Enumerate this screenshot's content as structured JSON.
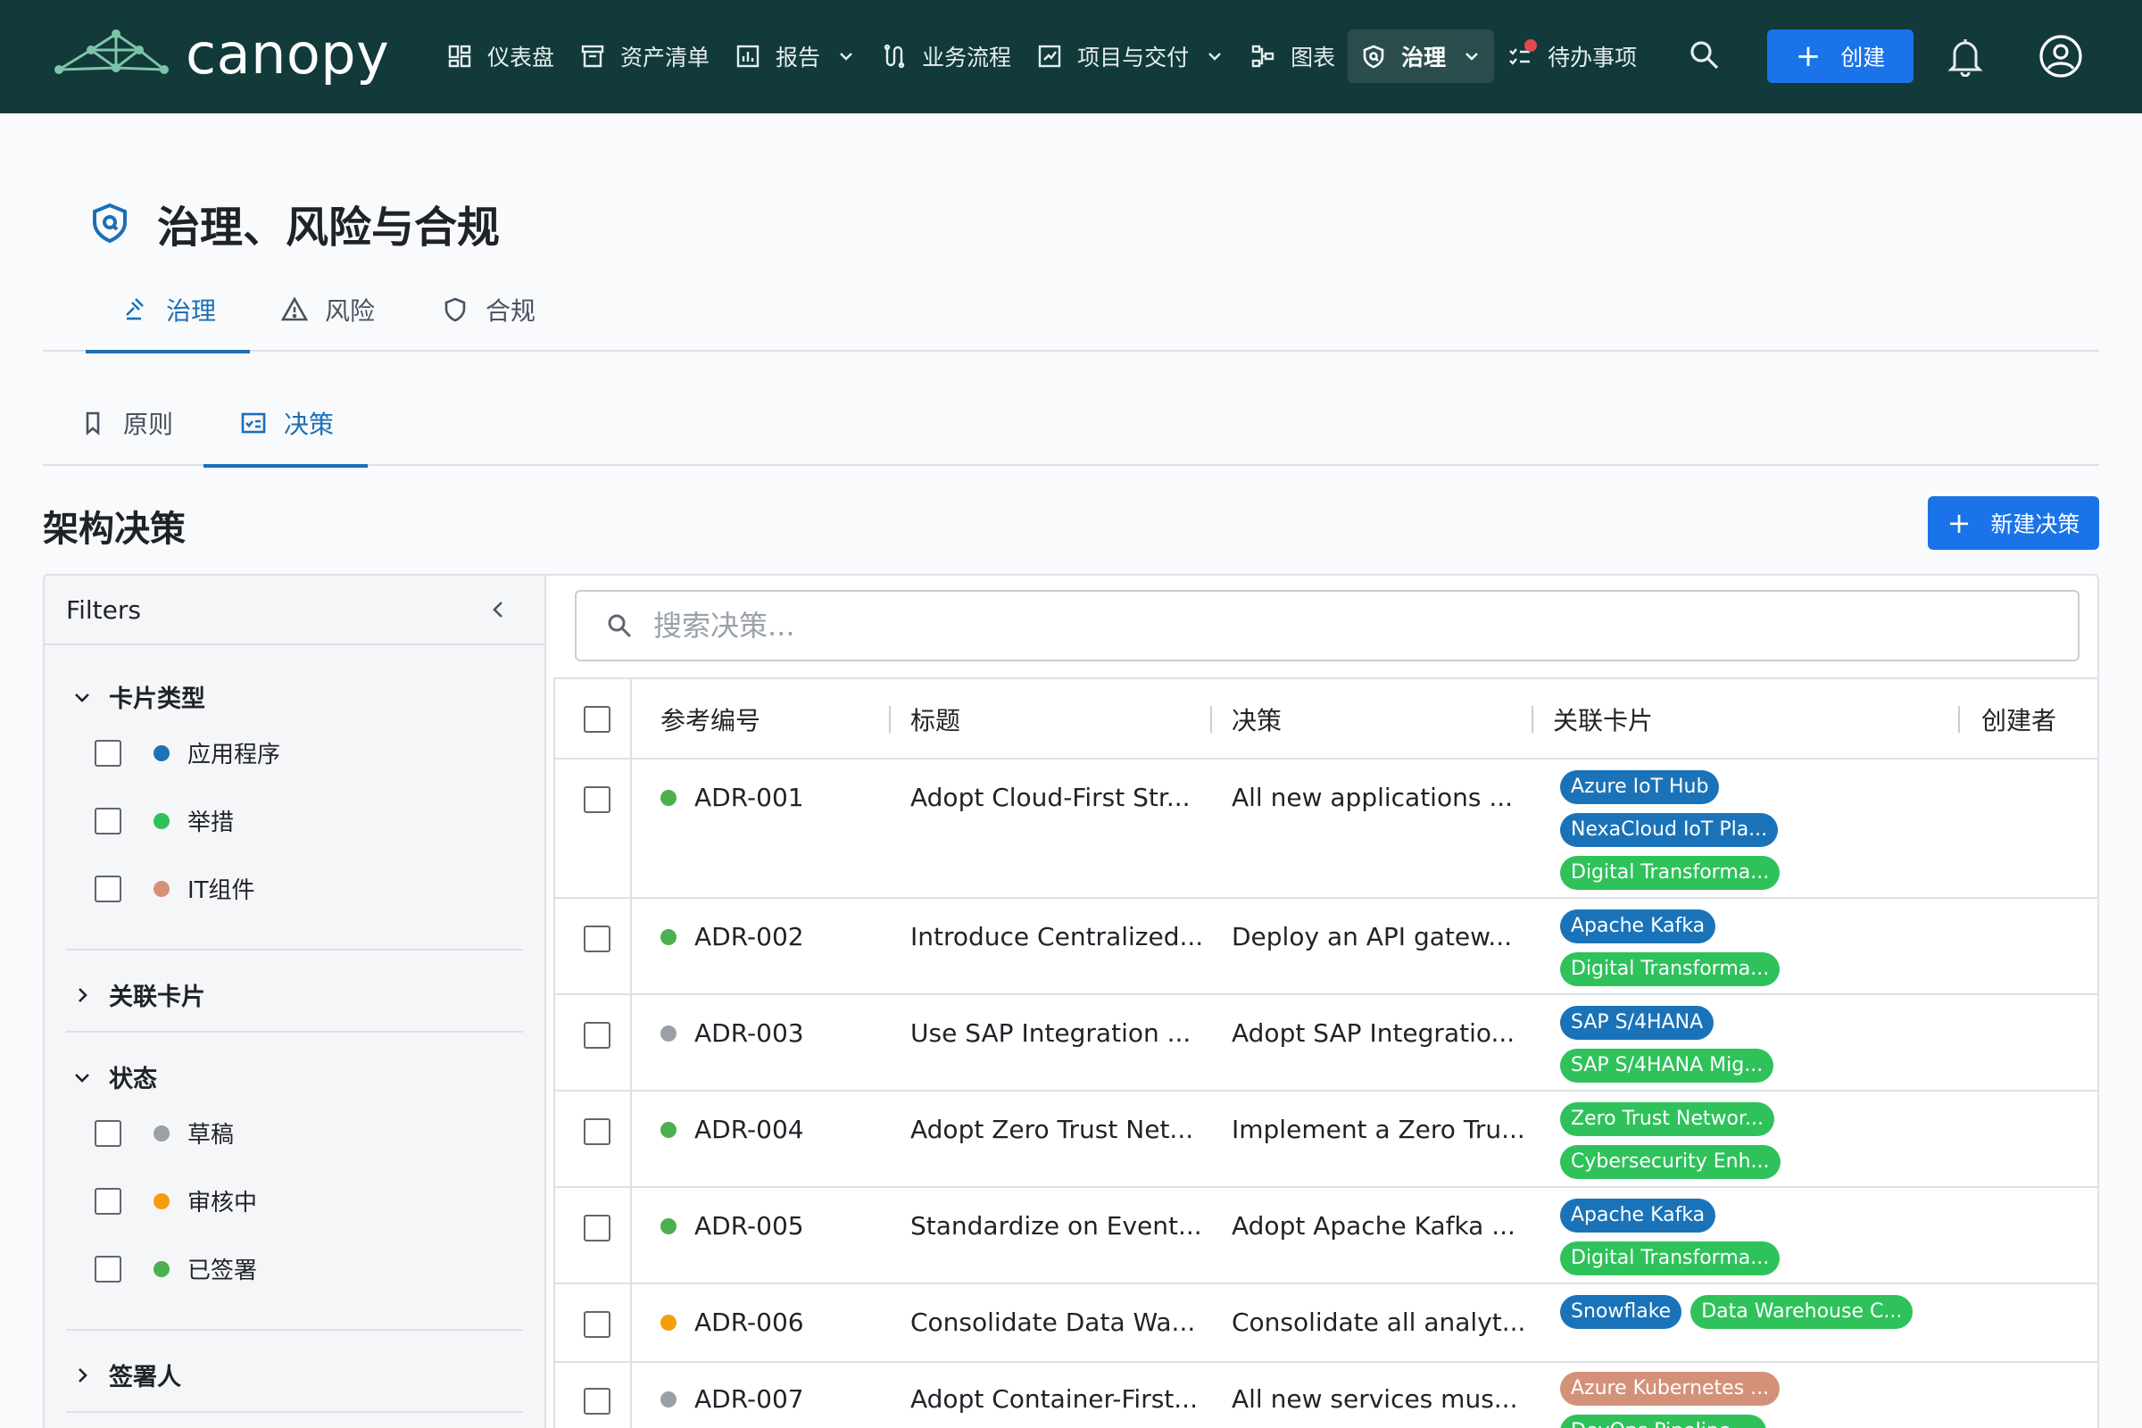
{
  "app": {
    "name": "canopy"
  },
  "nav": {
    "items": [
      {
        "label": "仪表盘",
        "icon": "dashboard-icon"
      },
      {
        "label": "资产清单",
        "icon": "inventory-icon"
      },
      {
        "label": "报告",
        "icon": "reports-icon",
        "dropdown": true
      },
      {
        "label": "业务流程",
        "icon": "workflow-icon"
      },
      {
        "label": "项目与交付",
        "icon": "delivery-icon",
        "dropdown": true
      },
      {
        "label": "图表",
        "icon": "diagram-icon"
      },
      {
        "label": "治理",
        "icon": "governance-shield-icon",
        "dropdown": true,
        "active": true
      },
      {
        "label": "待办事项",
        "icon": "todo-icon",
        "badge": true
      }
    ],
    "create_label": "创建"
  },
  "page": {
    "title": "治理、风险与合规",
    "tabs": [
      {
        "label": "治理",
        "active": true
      },
      {
        "label": "风险"
      },
      {
        "label": "合规"
      }
    ],
    "subtabs": [
      {
        "label": "原则"
      },
      {
        "label": "决策",
        "active": true
      }
    ],
    "section_title": "架构决策",
    "new_button": "新建决策"
  },
  "filters": {
    "title": "Filters",
    "groups": [
      {
        "label": "卡片类型",
        "expanded": true,
        "options": [
          {
            "label": "应用程序",
            "color": "#1a73e8"
          },
          {
            "label": "举措",
            "color": "#22c55e"
          },
          {
            "label": "IT组件",
            "color": "#d4917a"
          }
        ]
      },
      {
        "label": "关联卡片",
        "expanded": false
      },
      {
        "label": "状态",
        "expanded": true,
        "options": [
          {
            "label": "草稿",
            "color": "#9aa0a6"
          },
          {
            "label": "审核中",
            "color": "#f59e0b"
          },
          {
            "label": "已签署",
            "color": "#4caf50"
          }
        ]
      },
      {
        "label": "签署人",
        "expanded": false
      }
    ]
  },
  "search": {
    "placeholder": "搜索决策..."
  },
  "table": {
    "columns": [
      "参考编号",
      "标题",
      "决策",
      "关联卡片",
      "创建者"
    ],
    "rows": [
      {
        "ref": "ADR-001",
        "status_color": "#4caf50",
        "title": "Adopt Cloud-First Str...",
        "decision": "All new applications ...",
        "tags": [
          {
            "label": "Azure IoT Hub",
            "color": "#1a73b8"
          },
          {
            "label": "NexaCloud IoT Pla...",
            "color": "#1a73b8"
          },
          {
            "label": "Digital Transforma...",
            "color": "#2fc25b"
          }
        ]
      },
      {
        "ref": "ADR-002",
        "status_color": "#4caf50",
        "title": "Introduce Centralized...",
        "decision": "Deploy an API gatew...",
        "tags": [
          {
            "label": "Apache Kafka",
            "color": "#1a73b8"
          },
          {
            "label": "Digital Transforma...",
            "color": "#2fc25b"
          }
        ]
      },
      {
        "ref": "ADR-003",
        "status_color": "#9aa0a6",
        "title": "Use SAP Integration ...",
        "decision": "Adopt SAP Integratio...",
        "tags": [
          {
            "label": "SAP S/4HANA",
            "color": "#1a73b8"
          },
          {
            "label": "SAP S/4HANA Mig...",
            "color": "#2fc25b"
          }
        ]
      },
      {
        "ref": "ADR-004",
        "status_color": "#4caf50",
        "title": "Adopt Zero Trust Net...",
        "decision": "Implement a Zero Tru...",
        "tags": [
          {
            "label": "Zero Trust Networ...",
            "color": "#2fc25b"
          },
          {
            "label": "Cybersecurity Enh...",
            "color": "#2fc25b"
          }
        ]
      },
      {
        "ref": "ADR-005",
        "status_color": "#4caf50",
        "title": "Standardize on Event...",
        "decision": "Adopt Apache Kafka ...",
        "tags": [
          {
            "label": "Apache Kafka",
            "color": "#1a73b8"
          },
          {
            "label": "Digital Transforma...",
            "color": "#2fc25b"
          }
        ]
      },
      {
        "ref": "ADR-006",
        "status_color": "#f59e0b",
        "title": "Consolidate Data Wa...",
        "decision": "Consolidate all analyt...",
        "tags": [
          {
            "label": "Snowflake",
            "color": "#1a73b8"
          },
          {
            "label": "Data Warehouse C...",
            "color": "#2fc25b"
          }
        ],
        "inline_tags": true
      },
      {
        "ref": "ADR-007",
        "status_color": "#9aa0a6",
        "title": "Adopt Container-First...",
        "decision": "All new services mus...",
        "tags": [
          {
            "label": "Azure Kubernetes ...",
            "color": "#d4917a"
          },
          {
            "label": "DevOps Pipeline ...",
            "color": "#2fc25b"
          }
        ]
      }
    ]
  }
}
